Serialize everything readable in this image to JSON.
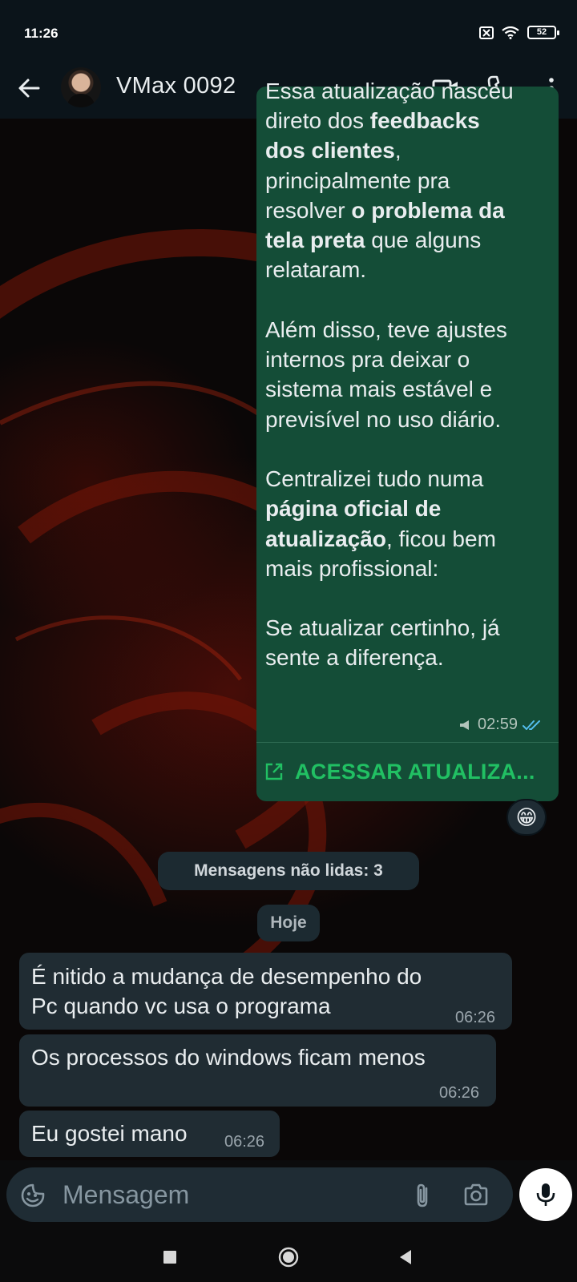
{
  "status_bar": {
    "time": "11:26",
    "battery": "52"
  },
  "header": {
    "contact_name": "VMax 0092"
  },
  "outgoing": {
    "top_cut": "Essa atualização nasceu",
    "line1_pre": "direto dos ",
    "line1_bold": "feedbacks",
    "line2_bold": "dos clientes",
    "line2_post": ",",
    "line3": "principalmente pra",
    "line4_pre": "resolver ",
    "line4_bold": "o problema da",
    "line5_bold": "tela preta",
    "line5_post": " que alguns",
    "line6": "relataram.",
    "para2_l1": "Além disso, teve ajustes",
    "para2_l2": "internos pra deixar o",
    "para2_l3": "sistema mais estável e",
    "para2_l4": "previsível no uso diário.",
    "para3_l1": "Centralizei tudo numa",
    "para3_l2_bold": "página oficial de",
    "para3_l3_bold": "atualização",
    "para3_l3_post": ", ficou bem",
    "para3_l4": "mais profissional:",
    "para4_l1": "Se atualizar certinho, já",
    "para4_l2": "sente a diferença.",
    "time": "02:59",
    "link_label": "ACESSAR ATUALIZA...",
    "reaction": "😁"
  },
  "divider": {
    "unread": "Mensagens não lidas: 3",
    "date": "Hoje"
  },
  "incoming": [
    {
      "line1": "É nitido a mudança de desempenho do",
      "line2": "Pc quando vc usa o programa",
      "time": "06:26"
    },
    {
      "line1": "Os processos do windows ficam menos",
      "time": "06:26"
    },
    {
      "line1": "Eu gostei mano",
      "time": "06:26"
    }
  ],
  "composer": {
    "placeholder": "Mensagem"
  },
  "colors": {
    "accent": "#21c063",
    "outgoing_bubble": "#144d37",
    "incoming_bubble": "#202c33",
    "header": "#0b141a"
  },
  "icons": [
    "back-arrow-icon",
    "video-call-icon",
    "phone-icon",
    "more-options-icon",
    "sticker-icon",
    "attach-icon",
    "camera-icon",
    "mic-icon",
    "external-link-icon",
    "read-ticks-icon",
    "broadcast-icon"
  ]
}
